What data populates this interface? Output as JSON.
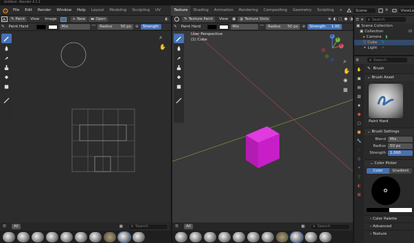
{
  "window": {
    "title": "Untitled - Blender 4.1.1"
  },
  "menubar": {
    "items": [
      "File",
      "Edit",
      "Render",
      "Window",
      "Help"
    ],
    "workspaces": [
      "Layout",
      "Modeling",
      "Sculpting",
      "UV Editing",
      "Texture Paint",
      "Shading",
      "Animation",
      "Rendering",
      "Compositing",
      "Geometry Nodes",
      "Scripting"
    ],
    "active_workspace": "Texture Paint",
    "scene": "Scene",
    "view_layer": "ViewLayer"
  },
  "image_editor": {
    "header": {
      "mode": "Paint",
      "view": "View",
      "image": "Image",
      "new": "New",
      "open": "Open"
    },
    "toolheader": {
      "brush": "Paint Hard",
      "blend": "Mix",
      "radius_label": "Radius",
      "radius_value": "50 px",
      "strength_label": "Strength"
    },
    "shelf_filter": "All",
    "shelf_search_placeholder": "Search"
  },
  "viewport": {
    "header": {
      "mode": "Texture Paint",
      "view": "View",
      "texture_slots": "Texture Slots"
    },
    "toolheader": {
      "brush": "Paint Hard",
      "blend": "Mix",
      "radius_label": "Radius",
      "radius_value": "50 px",
      "strength_label": "Strength",
      "strength_value": "1.00"
    },
    "overlay_title": "User Perspective",
    "overlay_object": "(1) Cube",
    "gizmo_axes": [
      "X",
      "Y",
      "Z"
    ],
    "shelf_filter": "All",
    "shelf_search_placeholder": "Search",
    "cube_color": "#c81ec8"
  },
  "outliner": {
    "search_placeholder": "Search",
    "items": [
      {
        "label": "Scene Collection"
      },
      {
        "label": "Collection"
      },
      {
        "label": "Cube"
      },
      {
        "label": "Camera"
      },
      {
        "label": "Light"
      }
    ]
  },
  "properties": {
    "search_placeholder": "Search",
    "brush_label": "Brush",
    "sections": {
      "brush_asset": "Brush Asset",
      "brush_settings": "Brush Settings",
      "color_picker": "Color Picker",
      "color_palette": "Color Palette",
      "advanced": "Advanced",
      "texture": "Texture"
    },
    "asset_name": "Paint Hard",
    "blend_label": "Blend",
    "blend_value": "Mix",
    "radius_label": "Radius",
    "radius_value": "50 px",
    "strength_label": "Strength",
    "strength_value": "1.000",
    "picker_tabs": [
      "Color",
      "Gradient"
    ]
  },
  "colors": {
    "accent": "#4772b3",
    "cube": "#c81ec8",
    "selected_text": "#ffa33a"
  }
}
